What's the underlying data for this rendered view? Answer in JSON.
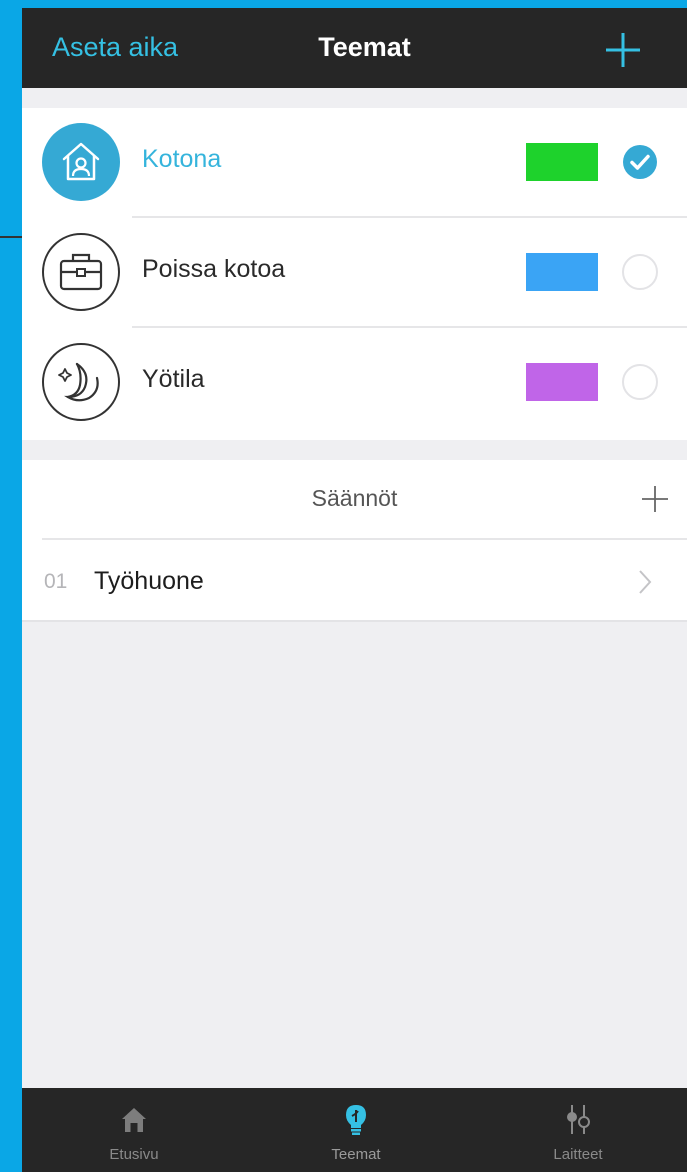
{
  "header": {
    "left_action": "Aseta aika",
    "title": "Teemat",
    "add_icon": "plus-icon"
  },
  "themes": [
    {
      "name": "Kotona",
      "icon": "home-icon",
      "color": "#1ed22c",
      "selected": true
    },
    {
      "name": "Poissa kotoa",
      "icon": "briefcase-icon",
      "color": "#3aa4f5",
      "selected": false
    },
    {
      "name": "Yötila",
      "icon": "moon-icon",
      "color": "#c065e8",
      "selected": false
    }
  ],
  "rules": {
    "header": "Säännöt",
    "items": [
      {
        "number": "01",
        "title": "Työhuone"
      }
    ]
  },
  "tabs": [
    {
      "label": "Etusivu",
      "icon": "home-icon"
    },
    {
      "label": "Teemat",
      "icon": "lightbulb-icon",
      "active": true
    },
    {
      "label": "Laitteet",
      "icon": "sliders-icon"
    }
  ],
  "colors": {
    "accent": "#35c0e3",
    "bar_bg": "#262626",
    "screen_bg": "#efeff2"
  }
}
